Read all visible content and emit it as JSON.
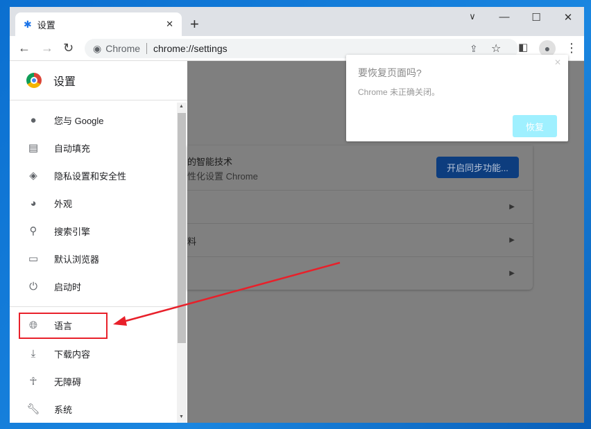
{
  "tab": {
    "title": "设置",
    "icon": "gear-icon"
  },
  "toolbar": {
    "site_label": "Chrome",
    "url": "chrome://settings"
  },
  "sidebar": {
    "title": "设置",
    "items": [
      {
        "label": "您与 Google",
        "icon": "person-icon"
      },
      {
        "label": "自动填充",
        "icon": "clipboard-icon"
      },
      {
        "label": "隐私设置和安全性",
        "icon": "shield-icon"
      },
      {
        "label": "外观",
        "icon": "palette-icon"
      },
      {
        "label": "搜索引擎",
        "icon": "search-icon"
      },
      {
        "label": "默认浏览器",
        "icon": "browser-icon"
      },
      {
        "label": "启动时",
        "icon": "power-icon"
      },
      {
        "label": "语言",
        "icon": "globe-icon"
      },
      {
        "label": "下载内容",
        "icon": "download-icon"
      },
      {
        "label": "无障碍",
        "icon": "accessibility-icon"
      },
      {
        "label": "系统",
        "icon": "wrench-icon"
      }
    ]
  },
  "main": {
    "sync_title": "的智能技术",
    "sync_sub": "性化设置 Chrome",
    "sync_button": "开启同步功能...",
    "row2_label": "料"
  },
  "popup": {
    "title": "要恢复页面吗?",
    "message": "Chrome 未正确关闭。",
    "restore_button": "恢复"
  },
  "colors": {
    "annotation": "#e8202a",
    "accent": "#1a73e8"
  }
}
